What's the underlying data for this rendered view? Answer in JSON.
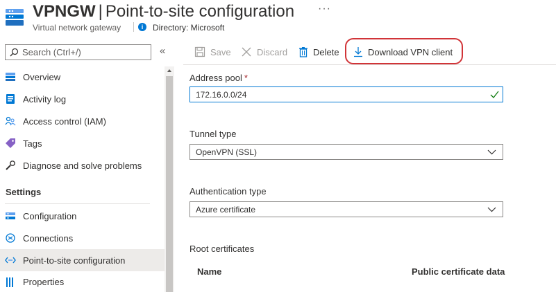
{
  "header": {
    "title_strong": "VPNGW",
    "title_separator": "|",
    "title_rest": "Point-to-site configuration",
    "more_label": "···",
    "subtitle": "Virtual network gateway",
    "directory": "Directory: Microsoft"
  },
  "sidebar": {
    "search_placeholder": "Search (Ctrl+/)",
    "collapse_label": "«",
    "items": [
      {
        "label": "Overview",
        "icon": "overview-icon"
      },
      {
        "label": "Activity log",
        "icon": "activity-log-icon"
      },
      {
        "label": "Access control (IAM)",
        "icon": "people-icon"
      },
      {
        "label": "Tags",
        "icon": "tag-icon"
      },
      {
        "label": "Diagnose and solve problems",
        "icon": "wrench-icon"
      }
    ],
    "section_label": "Settings",
    "settings_items": [
      {
        "label": "Configuration",
        "icon": "configuration-icon"
      },
      {
        "label": "Connections",
        "icon": "connections-icon"
      },
      {
        "label": "Point-to-site configuration",
        "icon": "point-to-site-icon",
        "selected": true
      },
      {
        "label": "Properties",
        "icon": "properties-icon"
      }
    ]
  },
  "toolbar": {
    "save_label": "Save",
    "discard_label": "Discard",
    "delete_label": "Delete",
    "download_label": "Download VPN client"
  },
  "form": {
    "address_pool_label": "Address pool",
    "required_marker": "*",
    "address_pool_value": "172.16.0.0/24",
    "tunnel_type_label": "Tunnel type",
    "tunnel_type_value": "OpenVPN (SSL)",
    "auth_type_label": "Authentication type",
    "auth_type_value": "Azure certificate",
    "root_certs_label": "Root certificates",
    "col_name": "Name",
    "col_public_cert": "Public certificate data"
  },
  "colors": {
    "accent": "#0078d4",
    "highlight_border": "#d13438",
    "selected_bg": "#edebe9"
  }
}
